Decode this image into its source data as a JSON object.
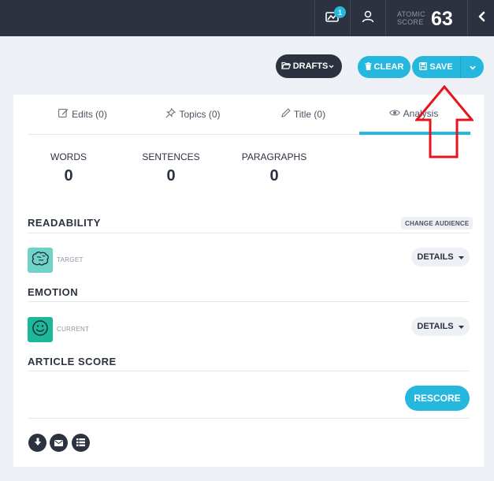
{
  "topbar": {
    "notification_count": "1",
    "atomic_label_line1": "ATOMIC",
    "atomic_label_line2": "SCORE",
    "atomic_score": "63",
    "icons": [
      "chart-bell-icon",
      "user-icon",
      "chevron-left-icon"
    ]
  },
  "actions": {
    "drafts_label": "DRAFTS",
    "clear_label": "CLEAR",
    "save_label": "SAVE"
  },
  "tabs": [
    {
      "label": "Edits (0)",
      "icon": "pencil-square-icon"
    },
    {
      "label": "Topics (0)",
      "icon": "pin-icon"
    },
    {
      "label": "Title (0)",
      "icon": "pencil-icon"
    },
    {
      "label": "Analysis",
      "icon": "eye-icon",
      "active": true
    }
  ],
  "stats": [
    {
      "label": "WORDS",
      "value": "0"
    },
    {
      "label": "SENTENCES",
      "value": "0"
    },
    {
      "label": "PARAGRAPHS",
      "value": "0"
    }
  ],
  "readability": {
    "title": "READABILITY",
    "change_audience_label": "CHANGE AUDIENCE",
    "sub_label": "TARGET",
    "details_label": "DETAILS",
    "icon": "brain-icon"
  },
  "emotion": {
    "title": "EMOTION",
    "sub_label": "CURRENT",
    "details_label": "DETAILS",
    "icon": "smiley-icon"
  },
  "article_score": {
    "title": "ARTICLE SCORE",
    "rescore_label": "RESCORE"
  },
  "footer_icons": [
    "download-icon",
    "email-icon",
    "list-icon"
  ],
  "colors": {
    "accent": "#26b7df",
    "dark": "#2c3240",
    "readability_tile": "#6fd3c8",
    "emotion_tile": "#1bb89c",
    "annotation_arrow": "#e8141c"
  }
}
